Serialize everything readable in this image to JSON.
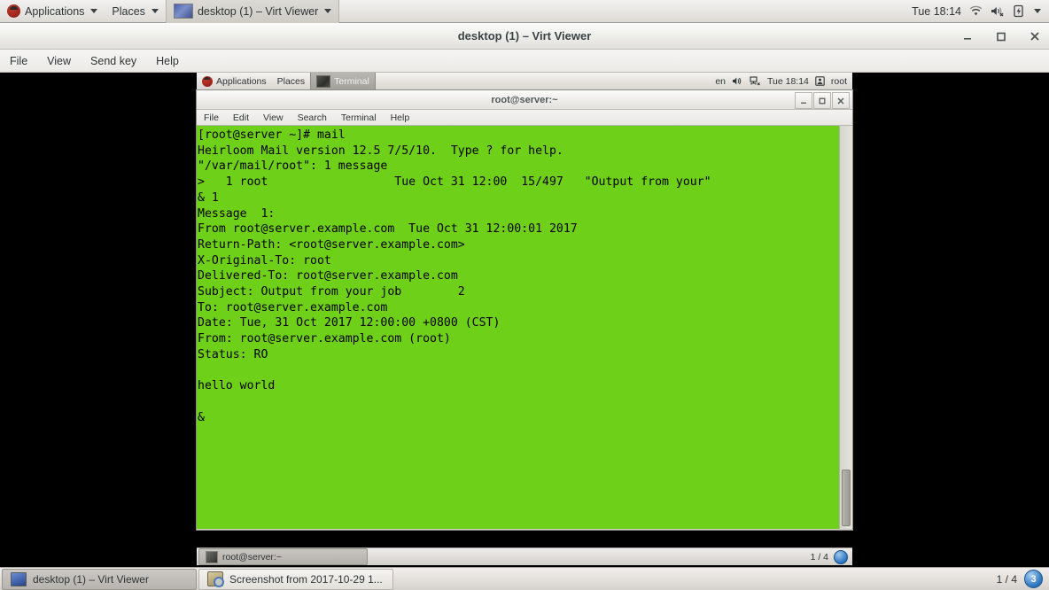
{
  "host_panel": {
    "applications_label": "Applications",
    "places_label": "Places",
    "active_window_label": "desktop (1) – Virt Viewer",
    "clock": "Tue 18:14",
    "icons": [
      "fedora-logo-icon",
      "wifi-icon",
      "speaker-muted-icon",
      "battery-icon",
      "chevron-down-icon"
    ]
  },
  "virt_viewer": {
    "title": "desktop (1) – Virt Viewer",
    "menus": [
      "File",
      "View",
      "Send key",
      "Help"
    ],
    "window_buttons": [
      "minimize",
      "maximize",
      "close"
    ]
  },
  "guest_panel": {
    "applications_label": "Applications",
    "places_label": "Places",
    "active_app_label": "Terminal",
    "keyboard_layout": "en",
    "clock": "Tue 18:14",
    "user": "root",
    "icons": [
      "fedora-logo-icon",
      "terminal-window-icon",
      "speaker-icon",
      "network-icon",
      "user-icon"
    ]
  },
  "terminal": {
    "title": "root@server:~",
    "menus": [
      "File",
      "Edit",
      "View",
      "Search",
      "Terminal",
      "Help"
    ],
    "window_buttons": [
      "minimize",
      "maximize",
      "close"
    ],
    "colors": {
      "background": "#6fd01a",
      "foreground": "#000000"
    },
    "lines": [
      "[root@server ~]# mail",
      "Heirloom Mail version 12.5 7/5/10.  Type ? for help.",
      "\"/var/mail/root\": 1 message",
      ">   1 root                  Tue Oct 31 12:00  15/497   \"Output from your\"",
      "& 1",
      "Message  1:",
      "From root@server.example.com  Tue Oct 31 12:00:01 2017",
      "Return-Path: <root@server.example.com>",
      "X-Original-To: root",
      "Delivered-To: root@server.example.com",
      "Subject: Output from your job        2",
      "To: root@server.example.com",
      "Date: Tue, 31 Oct 2017 12:00:00 +0800 (CST)",
      "From: root@server.example.com (root)",
      "Status: RO",
      "",
      "hello world",
      "",
      "&"
    ]
  },
  "guest_taskbar": {
    "task_label": "root@server:~",
    "workspace_count": "1 / 4",
    "workspace_badge": ""
  },
  "host_taskbar": {
    "tasks": [
      {
        "label": "desktop (1) – Virt Viewer",
        "active": true,
        "icon": "monitor-icon"
      },
      {
        "label": "Screenshot from 2017-10-29 1...",
        "active": false,
        "icon": "screenshot-icon"
      }
    ],
    "workspace_count": "1 / 4",
    "workspace_badge": "3"
  }
}
